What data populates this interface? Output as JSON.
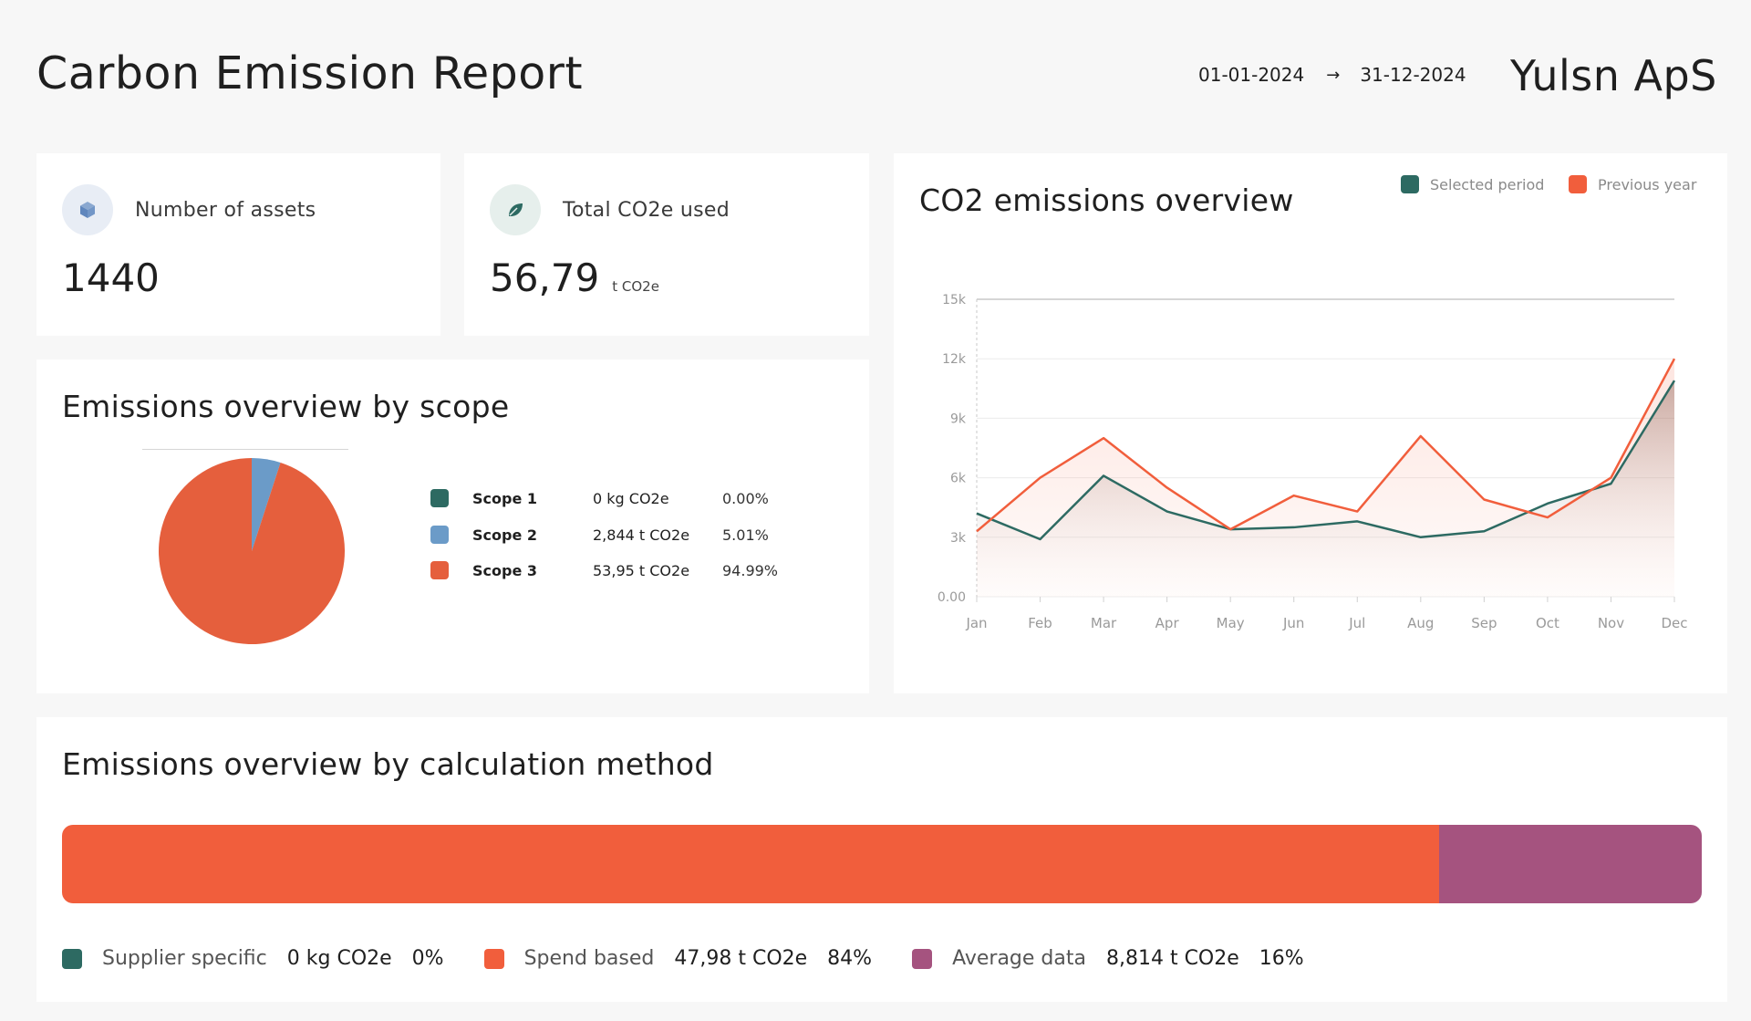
{
  "header": {
    "title": "Carbon Emission Report",
    "date_start": "01-01-2024",
    "date_arrow": "→",
    "date_end": "31-12-2024",
    "company": "Yulsn ApS"
  },
  "kpis": {
    "assets": {
      "icon": "cube-icon",
      "label": "Number of assets",
      "value": "1440"
    },
    "co2": {
      "icon": "leaf-icon",
      "label": "Total CO2e used",
      "value": "56,79",
      "unit": "t CO2e"
    }
  },
  "scope_card": {
    "title": "Emissions overview by scope",
    "items": [
      {
        "name": "Scope 1",
        "value": "0 kg CO2e",
        "pct": "0.00%",
        "color": "#2d6a62"
      },
      {
        "name": "Scope 2",
        "value": "2,844 t CO2e",
        "pct": "5.01%",
        "color": "#6b9bc8"
      },
      {
        "name": "Scope 3",
        "value": "53,95 t CO2e",
        "pct": "94.99%",
        "color": "#e55f3d"
      }
    ]
  },
  "line_card": {
    "title": "CO2 emissions overview",
    "legend": [
      {
        "name": "Selected period",
        "color": "#2d6a62"
      },
      {
        "name": "Previous year",
        "color": "#f15e3c"
      }
    ]
  },
  "method_card": {
    "title": "Emissions overview by calculation method",
    "items": [
      {
        "name": "Supplier specific",
        "value": "0 kg CO2e",
        "pct": "0%",
        "share": 0,
        "color": "#2d6a62"
      },
      {
        "name": "Spend based",
        "value": "47,98 t CO2e",
        "pct": "84%",
        "share": 0.84,
        "color": "#f15e3c"
      },
      {
        "name": "Average data",
        "value": "8,814 t CO2e",
        "pct": "16%",
        "share": 0.16,
        "color": "#a5537f"
      }
    ]
  },
  "chart_data": [
    {
      "type": "pie",
      "title": "Emissions overview by scope",
      "categories": [
        "Scope 1",
        "Scope 2",
        "Scope 3"
      ],
      "values": [
        0.0,
        5.01,
        94.99
      ],
      "colors": [
        "#2d6a62",
        "#6b9bc8",
        "#e55f3d"
      ]
    },
    {
      "type": "area",
      "title": "CO2 emissions overview",
      "x": [
        "Jan",
        "Feb",
        "Mar",
        "Apr",
        "May",
        "Jun",
        "Jul",
        "Aug",
        "Sep",
        "Oct",
        "Nov",
        "Dec"
      ],
      "ylim": [
        0,
        15000
      ],
      "yticks": [
        "0.00",
        "3k",
        "6k",
        "9k",
        "12k",
        "15k"
      ],
      "grid": true,
      "legend": "top-right",
      "series": [
        {
          "name": "Selected period",
          "color": "#2d6a62",
          "values": [
            4200,
            2900,
            6100,
            4300,
            3400,
            3500,
            3800,
            3000,
            3300,
            4700,
            5700,
            10900
          ]
        },
        {
          "name": "Previous year",
          "color": "#f15e3c",
          "values": [
            3300,
            6000,
            8000,
            5500,
            3400,
            5100,
            4300,
            8100,
            4900,
            4000,
            6000,
            12000
          ]
        }
      ]
    },
    {
      "type": "bar",
      "title": "Emissions overview by calculation method",
      "categories": [
        "Supplier specific",
        "Spend based",
        "Average data"
      ],
      "values": [
        0,
        84,
        16
      ],
      "colors": [
        "#2d6a62",
        "#f15e3c",
        "#a5537f"
      ]
    }
  ]
}
